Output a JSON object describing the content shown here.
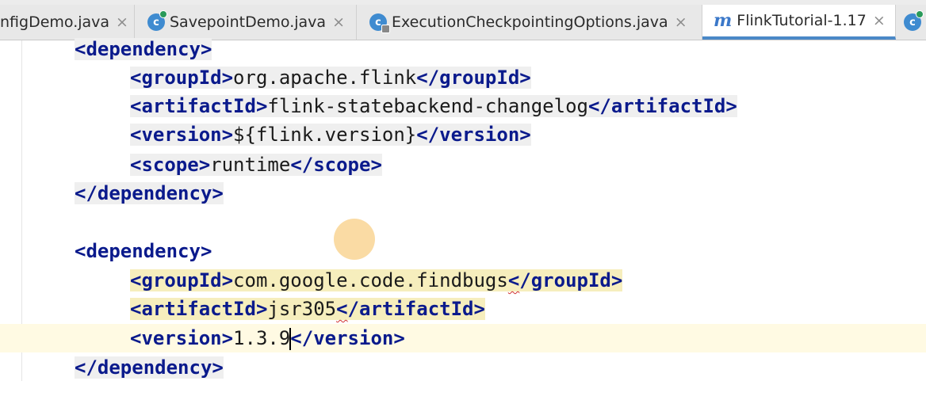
{
  "tabs": [
    {
      "label": "nfigDemo.java",
      "icon": "java-class-icon",
      "active": false
    },
    {
      "label": "SavepointDemo.java",
      "icon": "java-class-icon",
      "active": false
    },
    {
      "label": "ExecutionCheckpointingOptions.java",
      "icon": "java-class-readonly-icon",
      "active": false
    },
    {
      "label": "FlinkTutorial-1.17",
      "icon": "maven-icon",
      "active": true
    },
    {
      "label": "",
      "icon": "java-class-icon",
      "active": false
    }
  ],
  "close_glyph": "×",
  "maven_glyph": "m",
  "class_glyph": "c",
  "code": {
    "dep1_open": "<dependency>",
    "dep1_groupId_open": "<groupId>",
    "dep1_groupId_value": "org.apache.flink",
    "dep1_groupId_close": "</groupId>",
    "dep1_artifactId_open": "<artifactId>",
    "dep1_artifactId_value": "flink-statebackend-changelog",
    "dep1_artifactId_close": "</artifactId>",
    "dep1_version_open": "<version>",
    "dep1_version_value": "${flink.version}",
    "dep1_version_close": "</version>",
    "dep1_scope_open": "<scope>",
    "dep1_scope_value": "runtime",
    "dep1_scope_close": "</scope>",
    "dep1_close": "</dependency>",
    "dep2_open": "<dependency>",
    "dep2_groupId_open": "<groupId>",
    "dep2_groupId_value": "com.google.code.findbugs",
    "dep2_groupId_lt": "<",
    "dep2_groupId_close": "/groupId>",
    "dep2_artifactId_open": "<artifactId>",
    "dep2_artifactId_value": "jsr305",
    "dep2_artifactId_lt": "<",
    "dep2_artifactId_close": "/artifactId>",
    "dep2_version_open": "<version>",
    "dep2_version_value": "1.3.9",
    "dep2_version_close": "</version>",
    "dep2_close": "</dependency>"
  },
  "colors": {
    "tag": "#0a1a8c",
    "caret_line": "#fffae3",
    "tag_match_highlight": "#f6eebd",
    "active_tab_underline": "#4a88c7"
  }
}
